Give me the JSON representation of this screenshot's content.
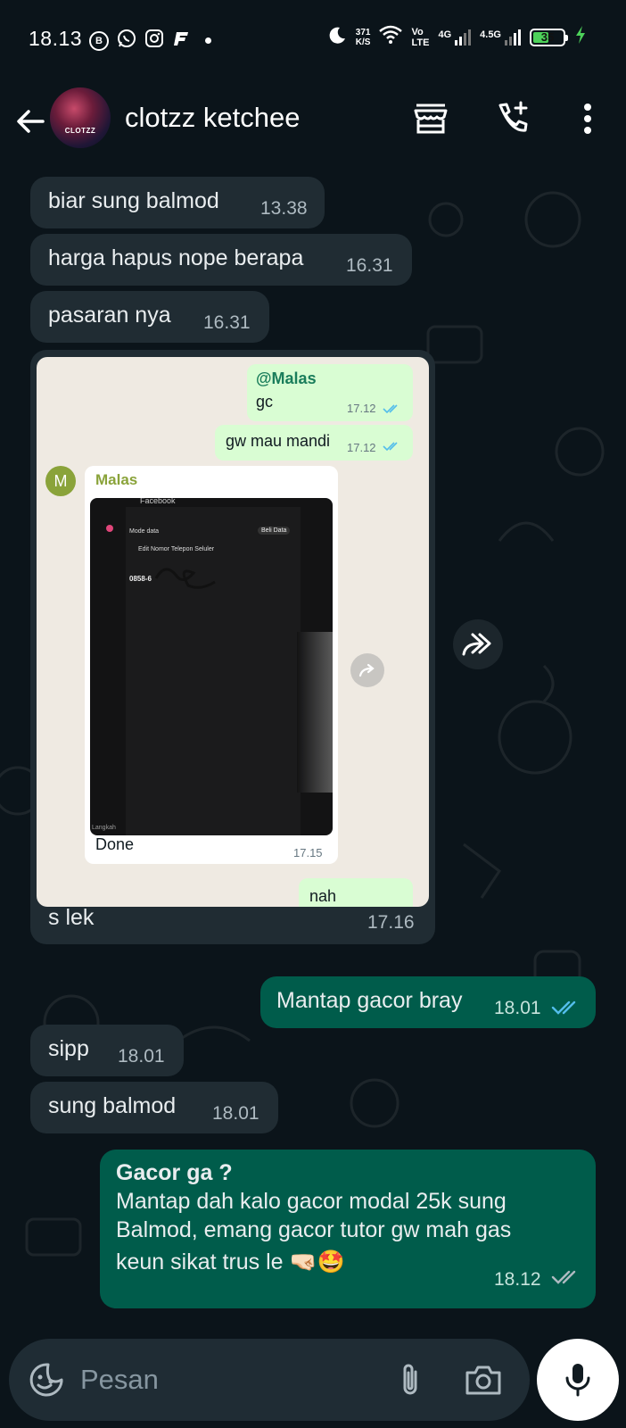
{
  "status_bar": {
    "time": "18.13",
    "speed_value": "371",
    "speed_unit": "K/S",
    "volte_1": "Vo",
    "volte_2": "LTE",
    "net_1": "4G",
    "net_2": "4.5G",
    "battery": "35"
  },
  "header": {
    "contact_name": "clotzz ketchee",
    "avatar_text": "CLOTZZ"
  },
  "messages": {
    "m1": {
      "text": "biar sung balmod",
      "time": "13.38"
    },
    "m2": {
      "text": "harga hapus nope berapa",
      "time": "16.31"
    },
    "m3": {
      "text": "pasaran nya",
      "time": "16.31"
    },
    "image_msg": {
      "quoted_mention": "@Malas",
      "quoted_text": "gc",
      "quoted_time": "17.12",
      "second_text": "gw mau mandi",
      "second_time": "17.12",
      "sender_initial": "M",
      "sender_name": "Malas",
      "screenshot_app": "Facebook",
      "screenshot_mode": "Mode data",
      "screenshot_buy": "Beli Data",
      "screenshot_title": "Edit Nomor Telepon Seluler",
      "screenshot_number": "0858-6",
      "screenshot_footer": "Langkah",
      "inner_caption": "Done",
      "inner_time": "17.15",
      "peek_text": "nah",
      "caption": "s lek",
      "time": "17.16"
    },
    "m5": {
      "text": "Mantap gacor bray",
      "time": "18.01"
    },
    "m6": {
      "text": "sipp",
      "time": "18.01"
    },
    "m7": {
      "text": "sung balmod",
      "time": "18.01"
    },
    "m8": {
      "title": "Gacor ga ?",
      "line1": "Mantap dah kalo gacor modal 25k sung",
      "line2": "Balmod, emang gacor tutor gw mah gas",
      "line3": "keun sikat trus le 🤜🏻🤩",
      "time": "18.12"
    }
  },
  "input": {
    "placeholder": "Pesan"
  },
  "colors": {
    "background": "#0b141a",
    "incoming": "#202c33",
    "outgoing": "#005c4b",
    "read_ticks": "#53bdeb"
  }
}
